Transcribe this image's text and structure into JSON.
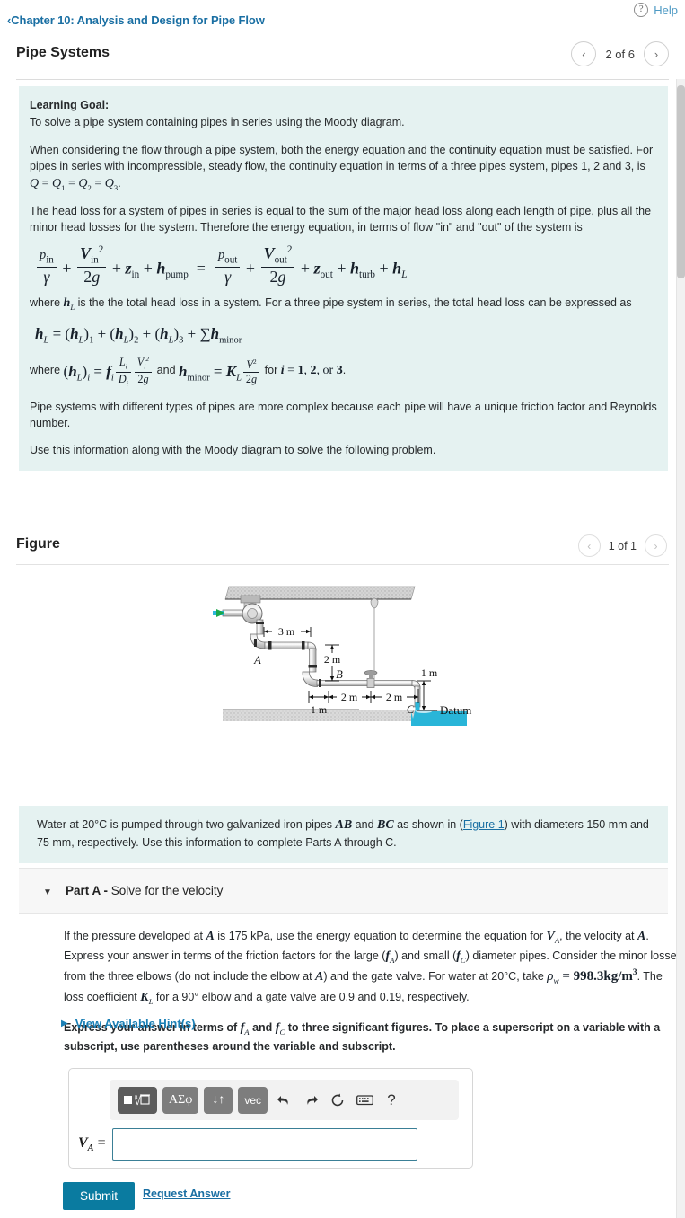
{
  "header": {
    "help_label": "Help",
    "help_icon": "question-circle-icon",
    "breadcrumb_chevron": "‹",
    "breadcrumb": "Chapter 10: Analysis and Design for Pipe Flow",
    "title": "Pipe Systems",
    "pager_prev": "‹",
    "pager_next": "›",
    "pager_count": "2 of 6"
  },
  "learning_goal": {
    "heading": "Learning Goal:",
    "subheading": "To solve a pipe system containing pipes in series using the Moody diagram.",
    "para1_a": "When considering the flow through a pipe system, both the energy equation and the continuity equation must be satisfied. For pipes in series with incompressible, steady flow, the continuity equation in terms of a three pipes system, pipes 1, 2 and 3, is ",
    "para1_eq": "Q = Q1 = Q2 = Q3",
    "para1_b": ".",
    "para2": "The head loss for a system of pipes in series is equal to the sum of the major head loss along each length of pipe, plus all the minor head losses for the system. Therefore the energy equation, in terms of flow \"in\" and \"out\" of the system is",
    "energy_equation": "p_in/γ + V_in²/2g + z_in + h_pump = p_out/γ + V_out²/2g + z_out + h_turb + h_L",
    "para3_a": "where ",
    "para3_sym": "h_L",
    "para3_b": " is the the total head loss in a system. For a three pipe system in series, the total head loss can be expressed as",
    "headloss_equation": "h_L = (h_L)_1 + (h_L)_2 + (h_L)_3 + Σ h_minor",
    "para4_a": "where ",
    "para4_eq": "(h_L)_i = f_i (L_i/D_i)(V_i²/2g)",
    "para4_b": " and ",
    "para4_eq2": "h_minor = K_L V²/2g",
    "para4_c": " for ",
    "para4_eq3": "i = 1, 2, or 3",
    "para4_d": ".",
    "para5": "Pipe systems with different types of pipes are more complex because each pipe will have a unique friction factor and Reynolds number.",
    "para6": "Use this information along with the Moody diagram to solve the following problem."
  },
  "figure_section": {
    "title": "Figure",
    "pager_prev": "‹",
    "pager_next": "›",
    "pager_count": "1 of 1",
    "diagram_labels": {
      "dim_3m": "3 m",
      "dim_2m_vert": "2 m",
      "dim_1m_left": "1 m",
      "dim_2m_a": "2 m",
      "dim_2m_b": "2 m",
      "dim_1m_right": "1 m",
      "point_a": "A",
      "point_b": "B",
      "point_c": "C",
      "datum": "Datum"
    }
  },
  "problem": {
    "text_a": "Water at 20°C is pumped through two galvanized iron pipes ",
    "pipe_ab": "AB",
    "text_b": " and ",
    "pipe_bc": "BC",
    "text_c": " as shown in (",
    "figure_link": "Figure 1",
    "text_d": ") with diameters 150 mm and 75 mm, respectively. Use this information to complete Parts A through C."
  },
  "part_a": {
    "toggle_icon": "triangle-down-icon",
    "label_bold": "Part A -",
    "label_rest": " Solve for the velocity",
    "question_1a": "If the pressure developed at ",
    "question_sym_a": "A",
    "question_1b": " is 175 kPa, use the energy equation to determine the equation for ",
    "question_sym_va": "V_A",
    "question_1c": ", the velocity at ",
    "question_sym_a2": "A",
    "question_1d": ". Express your answer in terms of the friction factors for the large (",
    "question_sym_fa": "f_A",
    "question_1e": ") and small (",
    "question_sym_fc": "f_C",
    "question_1f": ") diameter pipes. Consider the minor losses from the three elbows (do not include the elbow at ",
    "question_sym_a3": "A",
    "question_1g": ") and the gate valve. For water at 20°C, take ",
    "question_rho": "ρ_w = 998.3 kg/m³",
    "question_1h": ". The loss coefficient ",
    "question_sym_kl": "K_L",
    "question_1i": " for a 90° elbow and a gate valve are 0.9 and 0.19, respectively.",
    "note_a": "Express your answer in terms of ",
    "note_fa": "f_A",
    "note_b": " and ",
    "note_fc": "f_C",
    "note_c": " to three significant figures. To place a superscript on a variable with a subscript, use parentheses around the variable and subscript.",
    "hints_icon": "triangle-right-icon",
    "hints_label": "View Available Hint(s)"
  },
  "answer": {
    "toolbar": [
      {
        "name": "template-root-button",
        "label": "▪√☐"
      },
      {
        "name": "greek-symbols-button",
        "label": "ΑΣφ"
      },
      {
        "name": "arrows-button",
        "label": "↓↑"
      },
      {
        "name": "vector-button",
        "label": "vec"
      },
      {
        "name": "undo-icon",
        "label": "↰"
      },
      {
        "name": "redo-icon",
        "label": "↱"
      },
      {
        "name": "reset-icon",
        "label": "↻"
      },
      {
        "name": "keyboard-icon",
        "label": "⌨"
      },
      {
        "name": "help-icon",
        "label": "?"
      }
    ],
    "variable_label": "V",
    "variable_sub": "A",
    "equals": "=",
    "input_value": "",
    "input_placeholder": "",
    "submit_label": "Submit",
    "request_answer_label": "Request Answer"
  },
  "colors": {
    "accent": "#0a7ba0",
    "link": "#1a6fa3",
    "panel_bg": "#e5f2f1",
    "part_bg": "#f7f7f7"
  }
}
